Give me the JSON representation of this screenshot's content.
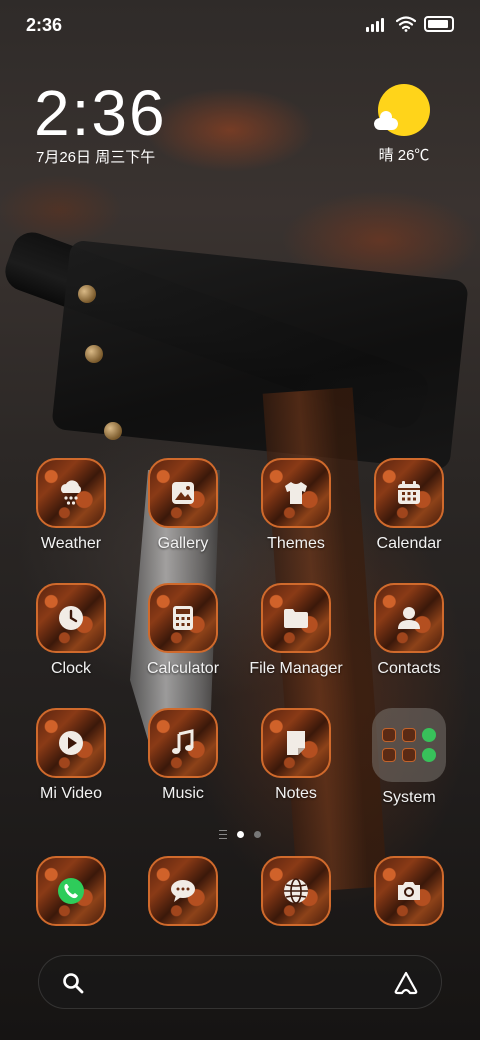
{
  "status_bar": {
    "time": "2:36"
  },
  "clock_widget": {
    "time": "2:36",
    "date": "7月26日 周三下午"
  },
  "weather_widget": {
    "text": "晴 26℃",
    "icon": "sunny-cloud-icon"
  },
  "apps": [
    {
      "label": "Weather",
      "icon": "weather-snow-icon"
    },
    {
      "label": "Gallery",
      "icon": "image-icon"
    },
    {
      "label": "Themes",
      "icon": "tshirt-icon"
    },
    {
      "label": "Calendar",
      "icon": "calendar-icon"
    },
    {
      "label": "Clock",
      "icon": "clock-icon"
    },
    {
      "label": "Calculator",
      "icon": "calculator-icon"
    },
    {
      "label": "File Manager",
      "icon": "folder-icon"
    },
    {
      "label": "Contacts",
      "icon": "person-icon"
    },
    {
      "label": "Mi Video",
      "icon": "play-icon"
    },
    {
      "label": "Music",
      "icon": "music-note-icon"
    },
    {
      "label": "Notes",
      "icon": "note-icon"
    },
    {
      "label": "System",
      "icon": "folder-grid-icon"
    }
  ],
  "dock": [
    {
      "name": "phone",
      "icon": "phone-icon"
    },
    {
      "name": "messages",
      "icon": "chat-bubble-icon"
    },
    {
      "name": "browser",
      "icon": "globe-icon"
    },
    {
      "name": "camera",
      "icon": "camera-icon"
    }
  ],
  "pager": {
    "pages": 2,
    "active": 1
  },
  "colors": {
    "tile_border": "#d06a2c",
    "sun": "#ffd41a",
    "phone_green": "#2ecc5a"
  }
}
